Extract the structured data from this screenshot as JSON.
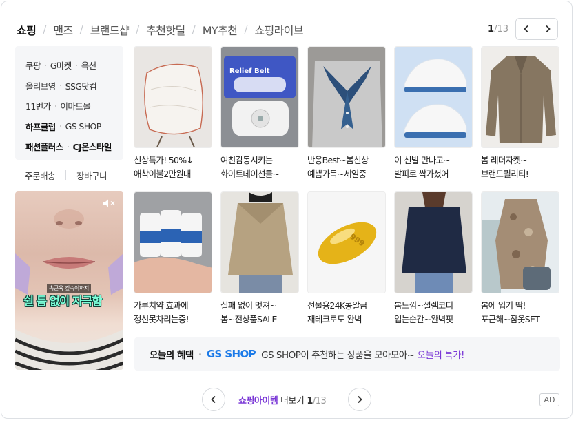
{
  "tabs": [
    {
      "label": "쇼핑",
      "active": true
    },
    {
      "label": "맨즈",
      "active": false
    },
    {
      "label": "브랜드샵",
      "active": false
    },
    {
      "label": "추천핫딜",
      "active": false
    },
    {
      "label": "MY추천",
      "active": false
    },
    {
      "label": "쇼핑라이브",
      "active": false
    }
  ],
  "pager": {
    "current": "1",
    "total": "/13",
    "prev_icon": "chevron-left-icon",
    "next_icon": "chevron-right-icon"
  },
  "stores": [
    [
      "쿠팡",
      "G마켓",
      "옥션"
    ],
    [
      "올리브영",
      "SSG닷컴"
    ],
    [
      "11번가",
      "이마트몰"
    ],
    [
      "하프클럽",
      "GS SHOP"
    ],
    [
      "패션플러스",
      "CJ온스타일"
    ]
  ],
  "store_links": {
    "orders": "주문배송",
    "cart": "장바구니"
  },
  "ad": {
    "sub_caption": "속근육 깊숙이까지",
    "main_caption": "쉴 틈 없이 자극함",
    "mute_icon": "speaker-mute-icon"
  },
  "products": [
    {
      "title": "신상특가! 50%↓\n애착이불2만원대",
      "image": "quilt-on-chair"
    },
    {
      "title": "여친감동시키는\n화이트데이선물~",
      "image": "relief-belt-massager"
    },
    {
      "title": "반응Best~봄신상\n예쁨가득~세일중",
      "image": "cardigan-with-scarf"
    },
    {
      "title": "이 신발 만나고~\n발피로 싹가셨어",
      "image": "white-sneakers"
    },
    {
      "title": "봄 레더자켓~\n브랜드퀄리티!",
      "image": "leather-jacket"
    },
    {
      "title": "가루치약 효과에\n정신못차리는중!",
      "image": "powder-toothpaste-bottles"
    },
    {
      "title": "실패 없이 멋져~\n봄~전상품SALE",
      "image": "trench-coat-back"
    },
    {
      "title": "선물용24K콩알금\n재테크로도 완벽",
      "image": "gold-bean"
    },
    {
      "title": "봄느낌~설렘코디\n입는순간~완벽핏",
      "image": "navy-jacket-jeans"
    },
    {
      "title": "봄에 입기 딱!\n포근해~잠옷SET",
      "image": "floral-pajama-set"
    }
  ],
  "benefit": {
    "title": "오늘의 혜택",
    "brand": "GS SHOP",
    "text": "GS SHOP이 추천하는 상품을 모아모아~",
    "link": "오늘의 특가!"
  },
  "footer": {
    "emphasis": "쇼핑아이템",
    "label": " 더보기",
    "current": "1",
    "total": "/13",
    "ad_badge": "AD"
  },
  "colors": {
    "accent_purple": "#7a37d6",
    "gs_blue": "#1b7ae8",
    "ad_text_green": "#7dffd9"
  }
}
